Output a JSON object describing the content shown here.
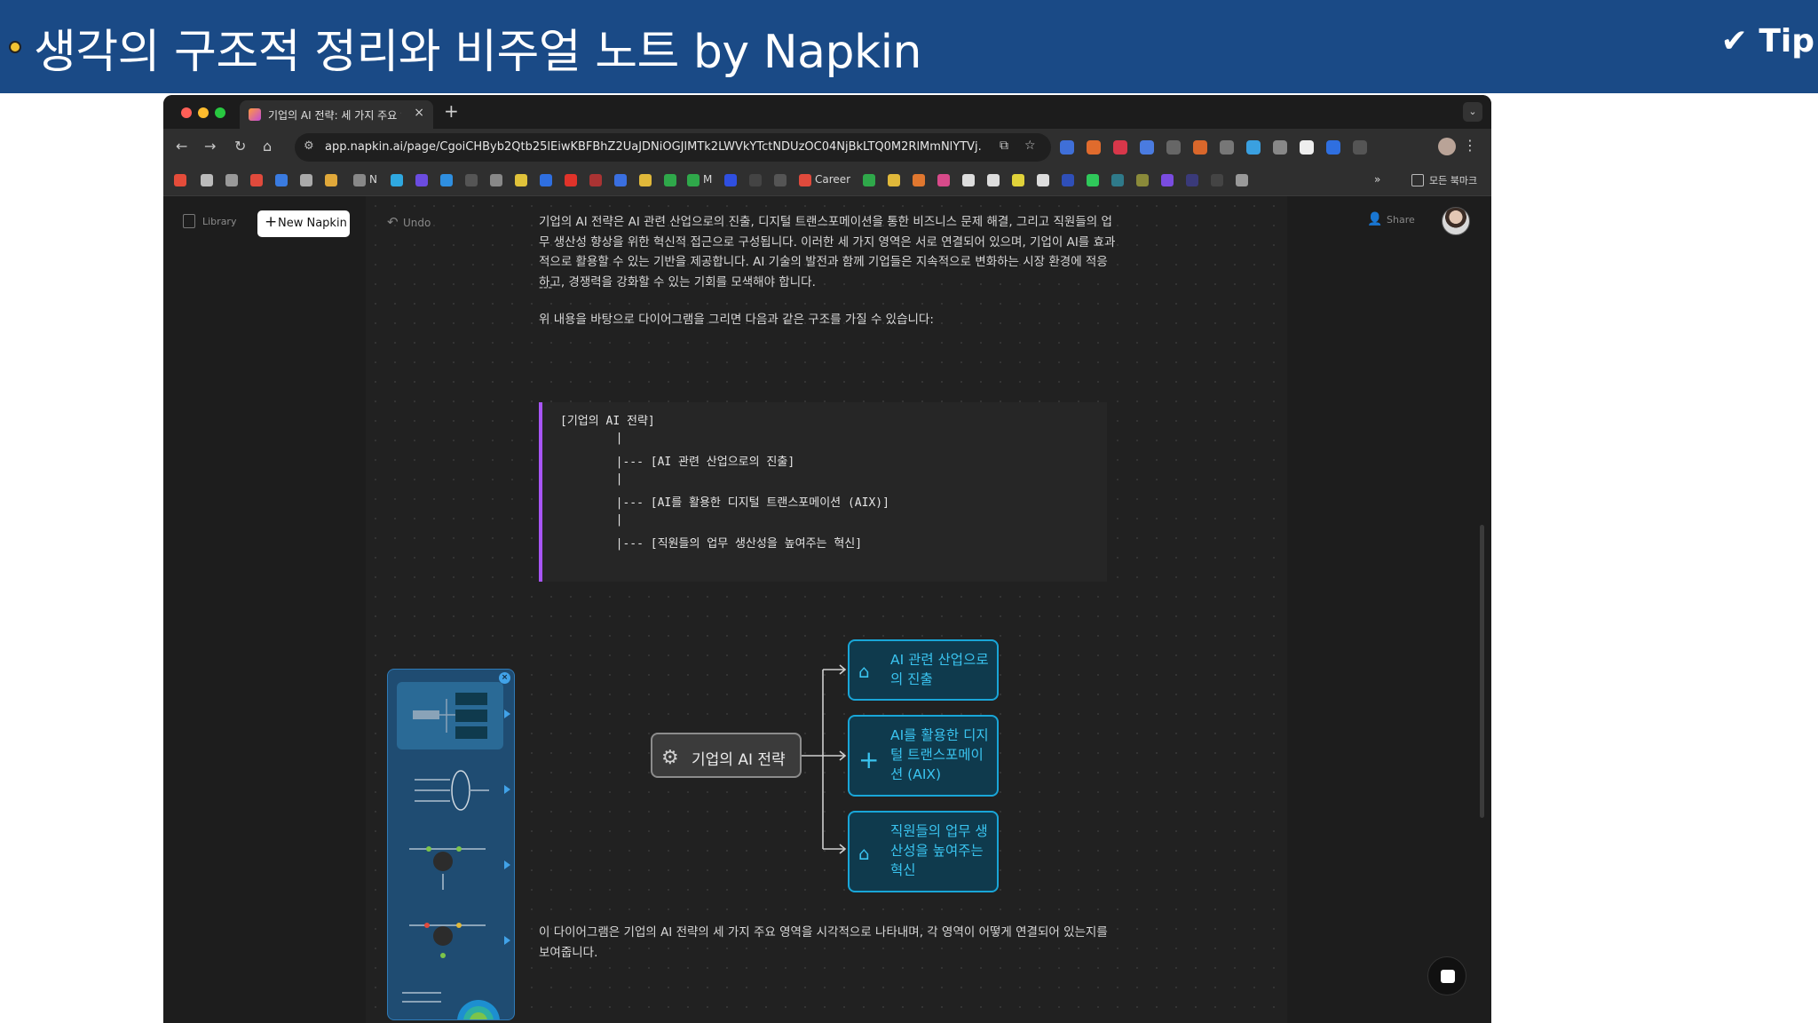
{
  "slide": {
    "title": "생각의 구조적 정리와 비주얼 노트 by Napkin",
    "tip": "✔ Tip"
  },
  "browser": {
    "tab_title": "기업의 AI 전략: 세 가지 주요 영역",
    "tab_close": "×",
    "new_tab": "+",
    "url": "app.napkin.ai/page/CgoiCHByb2Qtb25lEiwKBFBhZ2UaJDNiOGJlMTk2LWVkYTctNDUzOC04NjBkLTQ0M2RlMmNlYTVj...",
    "nav": {
      "back": "←",
      "forward": "→",
      "reload": "↻",
      "home": "⌂",
      "star": "☆",
      "menu": "⋮",
      "tabs_menu": "⌄"
    },
    "bookmarks": {
      "n": "N",
      "m": "M",
      "career": "Career",
      "more": "»",
      "all_bookmarks": "모든 북마크"
    }
  },
  "app": {
    "library_label": "Library",
    "new_napkin_label": "New Napkin",
    "undo_label": "Undo",
    "share_label": "Share",
    "paragraph_1": "기업의 AI 전략은 AI 관련 산업으로의 진출, 디지털 트랜스포메이션을 통한 비즈니스 문제 해결, 그리고 직원들의 업무 생산성 향상을 위한 혁신적 접근으로 구성됩니다. 이러한 세 가지 영역은 서로 연결되어 있으며, 기업이 AI를 효과적으로 활용할 수 있는 기반을 제공합니다. AI 기술의 발전과 함께 기업들은 지속적으로 변화하는 시장 환경에 적응하고, 경쟁력을 강화할 수 있는 기회를 모색해야 합니다.",
    "separator": "---",
    "paragraph_2": "위 내용을 바탕으로 다이어그램을 그리면 다음과 같은 구조를 가질 수 있습니다:",
    "code_lines": [
      "[기업의 AI 전략]",
      "        |",
      "        |--- [AI 관련 산업으로의 진출]",
      "        |",
      "        |--- [AI를 활용한 디지털 트랜스포메이션 (AIX)]",
      "        |",
      "        |--- [직원들의 업무 생산성을 높여주는 혁신]"
    ],
    "paragraph_3": "이 다이어그램은 기업의 AI 전략의 세 가지 주요 영역을 시각적으로 나타내며, 각 영역이 어떻게 연결되어 있는지를 보여줍니다.",
    "diagram": {
      "root": "기업의 AI 전략",
      "root_icon": "org-chart-icon",
      "children": [
        {
          "label": "AI 관련 산업으로의 진출",
          "icon": "factory-icon"
        },
        {
          "label": "AI를 활용한 디지털 트랜스포메이션 (AIX)",
          "icon": "plus-icon"
        },
        {
          "label": "직원들의 업무 생산성을 높여주는 혁신",
          "icon": "industry-icon"
        }
      ]
    }
  },
  "colors": {
    "banner": "#1a4a86",
    "accent_cyan": "#19a6d8",
    "code_border": "#a855f7",
    "picker_bg": "#1f4c72"
  }
}
